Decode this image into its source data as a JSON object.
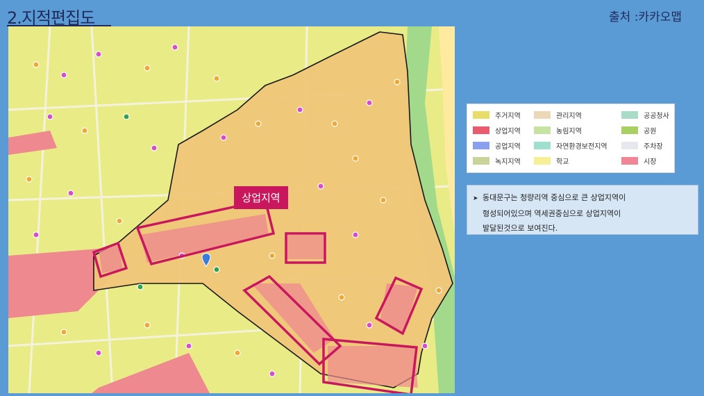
{
  "slide": {
    "title": "2.지적편집도",
    "source": "출처 :카카오맵"
  },
  "map": {
    "zone_label": "상업지역",
    "colors": {
      "background": "#5b9bd5",
      "residential": "#e9ec86",
      "commercial_area": "#f1c77a",
      "commercial": "#ee8a8f",
      "river": "#a3d98a",
      "boundary": "#111111",
      "highlight": "#c8175d"
    }
  },
  "legend": {
    "items": [
      {
        "label": "주거지역",
        "color": "#e8dd6a"
      },
      {
        "label": "관리지역",
        "color": "#ead8b8"
      },
      {
        "label": "공공청사",
        "color": "#a8dcc8"
      },
      {
        "label": "상업지역",
        "color": "#e95b6e"
      },
      {
        "label": "농림지역",
        "color": "#c6e3a4"
      },
      {
        "label": "공원",
        "color": "#a9d063"
      },
      {
        "label": "공업지역",
        "color": "#8b9ff0"
      },
      {
        "label": "자연환경보전지역",
        "color": "#9edfcd"
      },
      {
        "label": "주차장",
        "color": "#e7e7ef"
      },
      {
        "label": "녹지지역",
        "color": "#c8d49a"
      },
      {
        "label": "학교",
        "color": "#f6ef96"
      },
      {
        "label": "시장",
        "color": "#f08595"
      }
    ]
  },
  "note": {
    "line1": "동대문구는 청량리역 중심으로 큰 상업지역이",
    "line2": "형성되어있으며 역세권중심으로 상업지역이",
    "line3": "발달된것으로 보여진다."
  }
}
